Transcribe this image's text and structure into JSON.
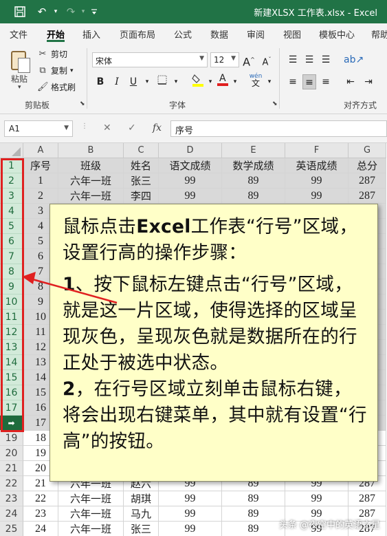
{
  "titlebar": {
    "document_title": "新建XLSX 工作表.xlsx  -  Excel",
    "quick_access": [
      "save-icon",
      "undo-icon",
      "redo-icon",
      "customize-icon"
    ],
    "bg": "#217346"
  },
  "ribbon_tabs": [
    "文件",
    "开始",
    "插入",
    "页面布局",
    "公式",
    "数据",
    "审阅",
    "视图",
    "模板中心",
    "帮助"
  ],
  "ribbon_active_tab": "开始",
  "ribbon": {
    "clipboard": {
      "paste": "粘贴",
      "cut": "剪切",
      "copy": "复制",
      "format_painter": "格式刷",
      "group": "剪贴板"
    },
    "font": {
      "name": "宋体",
      "size": "12",
      "grow": "A",
      "shrink": "A",
      "group": "字体",
      "bold": "B",
      "italic": "I",
      "underline": "U"
    },
    "alignment": {
      "group": "对齐方式"
    }
  },
  "formula_bar": {
    "name_box": "A1",
    "cancel": "✕",
    "enter": "✓",
    "fx": "fx",
    "value": "序号"
  },
  "columns": [
    "A",
    "B",
    "C",
    "D",
    "E",
    "F",
    "G"
  ],
  "rows": [
    {
      "n": "1",
      "cells": [
        "序号",
        "班级",
        "姓名",
        "语文成绩",
        "数学成绩",
        "英语成绩",
        "总分"
      ]
    },
    {
      "n": "2",
      "cells": [
        "1",
        "六年一班",
        "张三",
        "99",
        "89",
        "99",
        "287"
      ]
    },
    {
      "n": "3",
      "cells": [
        "2",
        "六年一班",
        "李四",
        "99",
        "89",
        "99",
        "287"
      ]
    },
    {
      "n": "4",
      "cells": [
        "3",
        "",
        "",
        "",
        "",
        "",
        ""
      ]
    },
    {
      "n": "5",
      "cells": [
        "4",
        "",
        "",
        "",
        "",
        "",
        ""
      ]
    },
    {
      "n": "6",
      "cells": [
        "5",
        "",
        "",
        "",
        "",
        "",
        ""
      ]
    },
    {
      "n": "7",
      "cells": [
        "6",
        "",
        "",
        "",
        "",
        "",
        ""
      ]
    },
    {
      "n": "8",
      "cells": [
        "7",
        "",
        "",
        "",
        "",
        "",
        ""
      ]
    },
    {
      "n": "9",
      "cells": [
        "8",
        "",
        "",
        "",
        "",
        "",
        ""
      ]
    },
    {
      "n": "10",
      "cells": [
        "9",
        "",
        "",
        "",
        "",
        "",
        ""
      ]
    },
    {
      "n": "11",
      "cells": [
        "10",
        "",
        "",
        "",
        "",
        "",
        ""
      ]
    },
    {
      "n": "12",
      "cells": [
        "11",
        "",
        "",
        "",
        "",
        "",
        ""
      ]
    },
    {
      "n": "13",
      "cells": [
        "12",
        "",
        "",
        "",
        "",
        "",
        ""
      ]
    },
    {
      "n": "14",
      "cells": [
        "13",
        "",
        "",
        "",
        "",
        "",
        ""
      ]
    },
    {
      "n": "15",
      "cells": [
        "14",
        "",
        "",
        "",
        "",
        "",
        ""
      ]
    },
    {
      "n": "16",
      "cells": [
        "15",
        "",
        "",
        "",
        "",
        "",
        ""
      ]
    },
    {
      "n": "17",
      "cells": [
        "16",
        "",
        "",
        "",
        "",
        "",
        ""
      ]
    },
    {
      "n": "18",
      "cells": [
        "17",
        "",
        "",
        "",
        "",
        "",
        ""
      ]
    },
    {
      "n": "19",
      "cells": [
        "18",
        "",
        "",
        "",
        "",
        "",
        ""
      ]
    },
    {
      "n": "20",
      "cells": [
        "19",
        "",
        "",
        "",
        "",
        "",
        ""
      ]
    },
    {
      "n": "21",
      "cells": [
        "20",
        "",
        "",
        "",
        "",
        "",
        ""
      ]
    },
    {
      "n": "22",
      "cells": [
        "21",
        "六年一班",
        "赵六",
        "99",
        "89",
        "99",
        "287"
      ]
    },
    {
      "n": "23",
      "cells": [
        "22",
        "六年一班",
        "胡琪",
        "99",
        "89",
        "99",
        "287"
      ]
    },
    {
      "n": "24",
      "cells": [
        "23",
        "六年一班",
        "马九",
        "99",
        "89",
        "99",
        "287"
      ]
    },
    {
      "n": "25",
      "cells": [
        "24",
        "六年一班",
        "张三",
        "99",
        "89",
        "99",
        "287"
      ]
    }
  ],
  "selected_rows": "1-18",
  "callout": {
    "para1_prefix": "鼠标点击",
    "para1_bold": "Excel",
    "para1_rest": "工作表“行号”区域，设置行高的操作步骤：",
    "step1_num": "1",
    "step1_text": "、按下鼠标左键点击“行号”区域，就是这一片区域，使得选择的区域呈现灰色，呈现灰色就是数据所在的行正处于被选中状态。",
    "step2_num": "2",
    "step2_text": "，在行号区域立刻单击鼠标右键，将会出现右键菜单，其中就有设置“行高”的按钮。"
  },
  "watermark": "头条 @夜空中的英语之星",
  "colors": {
    "accent": "#217346",
    "selection_frame": "#e02020",
    "callout_bg": "#ffffc8",
    "row_selected": "#d2ead9"
  }
}
